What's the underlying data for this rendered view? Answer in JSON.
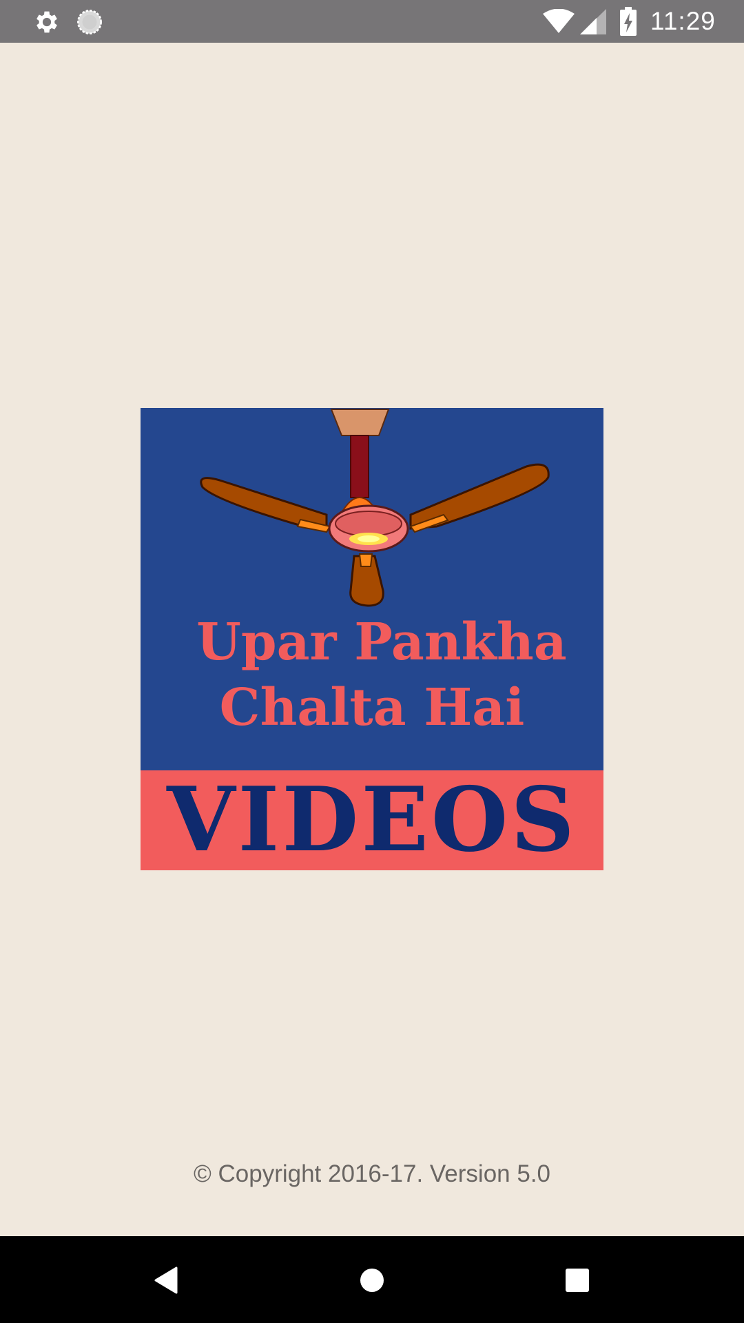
{
  "status_bar": {
    "time": "11:29",
    "icons": [
      "gear-icon",
      "sync-icon",
      "wifi-icon",
      "signal-icon",
      "battery-charging-icon"
    ]
  },
  "splash": {
    "logo_line1": "Upar Pankha",
    "logo_line2": "Chalta Hai",
    "logo_banner": "VIDEOS",
    "logo_image": "ceiling-fan-icon",
    "colors": {
      "background": "#f0e8dd",
      "logo_blue": "#24478f",
      "logo_red": "#f25c5c",
      "banner_text": "#0f2a6e"
    }
  },
  "footer": {
    "copyright": "© Copyright 2016-17. Version 5.0"
  },
  "nav_bar": {
    "buttons": [
      "back-icon",
      "home-icon",
      "recent-apps-icon"
    ]
  }
}
